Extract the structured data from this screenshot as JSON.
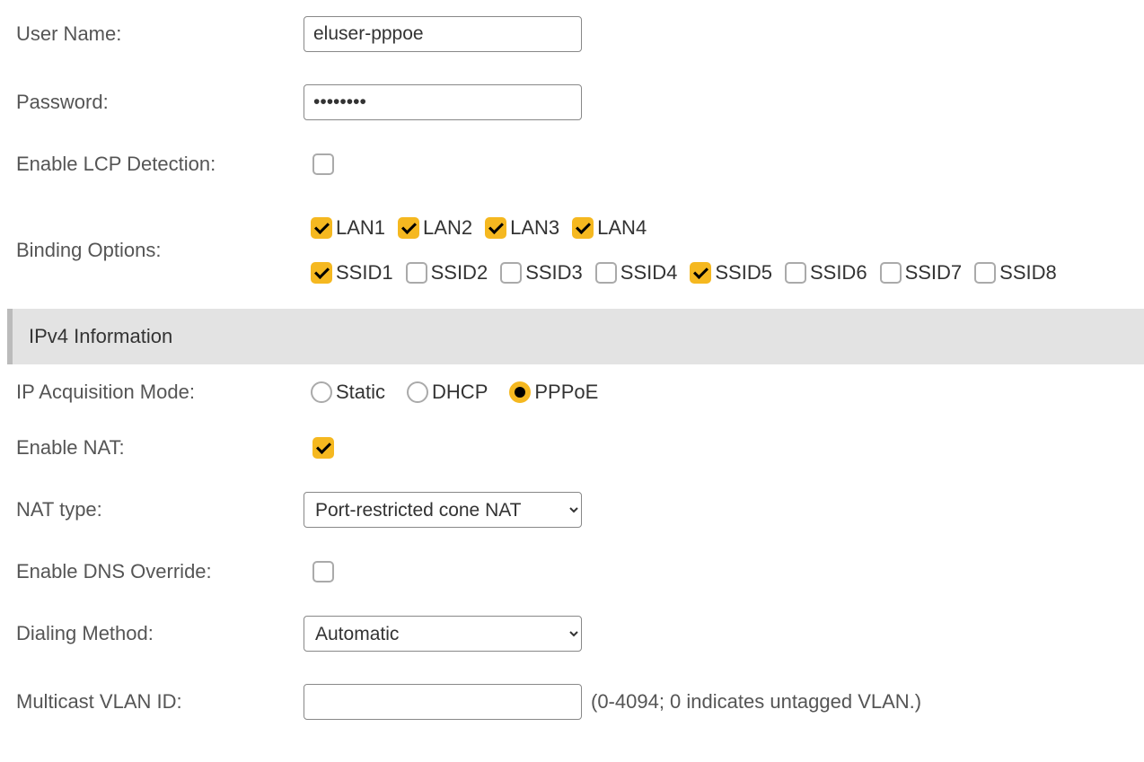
{
  "fields": {
    "user_name": {
      "label": "User Name:",
      "value": "eluser-pppoe"
    },
    "password": {
      "label": "Password:",
      "value": "••••••••"
    },
    "enable_lcp": {
      "label": "Enable LCP Detection:",
      "checked": false
    },
    "binding": {
      "label": "Binding Options:",
      "lan": [
        {
          "label": "LAN1",
          "checked": true
        },
        {
          "label": "LAN2",
          "checked": true
        },
        {
          "label": "LAN3",
          "checked": true
        },
        {
          "label": "LAN4",
          "checked": true
        }
      ],
      "ssid": [
        {
          "label": "SSID1",
          "checked": true
        },
        {
          "label": "SSID2",
          "checked": false
        },
        {
          "label": "SSID3",
          "checked": false
        },
        {
          "label": "SSID4",
          "checked": false
        },
        {
          "label": "SSID5",
          "checked": true
        },
        {
          "label": "SSID6",
          "checked": false
        },
        {
          "label": "SSID7",
          "checked": false
        },
        {
          "label": "SSID8",
          "checked": false
        }
      ]
    },
    "ipv4_header": "IPv4 Information",
    "ip_mode": {
      "label": "IP Acquisition Mode:",
      "options": [
        {
          "label": "Static",
          "checked": false
        },
        {
          "label": "DHCP",
          "checked": false
        },
        {
          "label": "PPPoE",
          "checked": true
        }
      ]
    },
    "enable_nat": {
      "label": "Enable NAT:",
      "checked": true
    },
    "nat_type": {
      "label": "NAT type:",
      "value": "Port-restricted cone NAT"
    },
    "enable_dns_override": {
      "label": "Enable DNS Override:",
      "checked": false
    },
    "dialing_method": {
      "label": "Dialing Method:",
      "value": "Automatic"
    },
    "multicast_vlan": {
      "label": "Multicast VLAN ID:",
      "value": "",
      "hint": "(0-4094; 0 indicates untagged VLAN.)"
    }
  }
}
